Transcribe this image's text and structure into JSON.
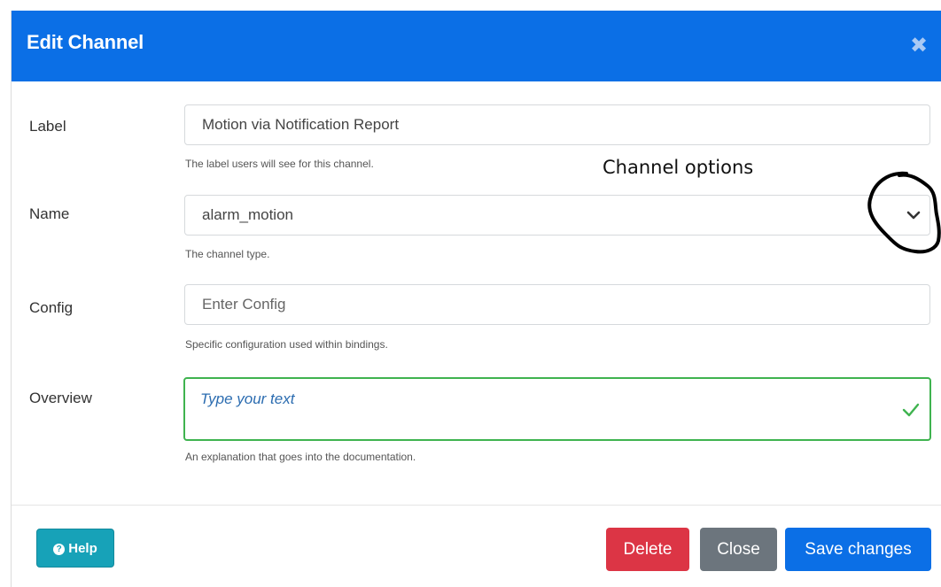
{
  "dialog": {
    "title": "Edit Channel",
    "close_icon": "close-icon"
  },
  "fields": {
    "label": {
      "label": "Label",
      "value": "Motion via Notification Report",
      "help": "The label users will see for this channel."
    },
    "name": {
      "label": "Name",
      "value": "alarm_motion",
      "help": "The channel type.",
      "icon": "chevron-down-icon"
    },
    "config": {
      "label": "Config",
      "placeholder": "Enter Config",
      "help": "Specific configuration used within bindings."
    },
    "overview": {
      "label": "Overview",
      "placeholder": "Type your text",
      "help": "An explanation that goes into the documentation.",
      "icon": "check-icon"
    }
  },
  "annotation": {
    "text": "Channel options"
  },
  "footer": {
    "help_label": "Help",
    "help_icon": "question-circle-icon",
    "delete_label": "Delete",
    "close_label": "Close",
    "save_label": "Save changes"
  },
  "colors": {
    "header": "#0b6fe6",
    "help_button": "#17a2b8",
    "delete_button": "#dc3545",
    "close_button": "#6c757d",
    "save_button": "#0b6fe6",
    "valid_border": "#3fb34f"
  }
}
